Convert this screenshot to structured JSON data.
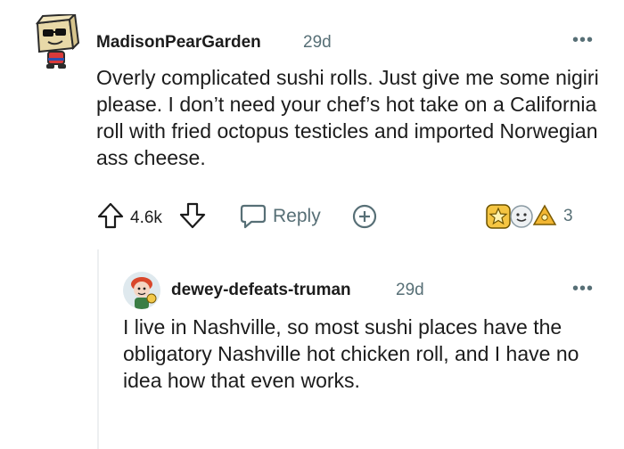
{
  "comment": {
    "author": "MadisonPearGarden",
    "age": "29d",
    "more": "•••",
    "body": "Overly complicated sushi rolls. Just give me some nigiri please. I don’t need your chef’s hot take on a California roll with fried octopus testicles and imported Norwegian ass cheese.",
    "score": "4.6k",
    "reply_label": "Reply",
    "award_count": "3"
  },
  "reply": {
    "author": "dewey-defeats-truman",
    "age": "29d",
    "more": "•••",
    "body": "I live in Nashville, so most sushi places have the obligatory Nashville hot chicken roll, and I have no idea how that even works."
  },
  "icons": {
    "avatar1": "snoo-avatar-cube-sunglasses",
    "upvote": "upvote-arrow-icon",
    "downvote": "downvote-arrow-icon",
    "reply": "speech-bubble-icon",
    "award": "plus-circle-icon",
    "awards": [
      "star-award-icon",
      "wholesome-award-icon",
      "gold-award-icon"
    ],
    "avatar2": "snoo-avatar-red-hair"
  },
  "colors": {
    "text": "#1c1c1c",
    "meta": "#576f76",
    "thread_line": "#edeff1"
  }
}
